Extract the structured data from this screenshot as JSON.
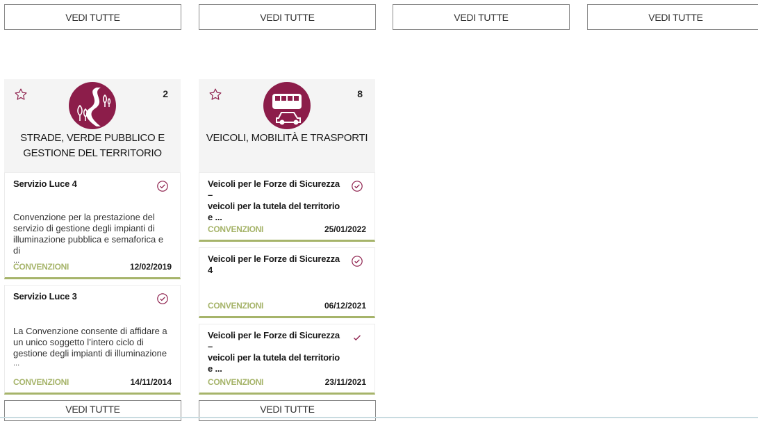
{
  "top_buttons": [
    "VEDI TUTTE",
    "VEDI TUTTE",
    "VEDI TUTTE",
    "VEDI TUTTE"
  ],
  "colors": {
    "accent": "#8c1d4a",
    "category_bar": "#a6b46a",
    "card_bg": "#f4f4f4"
  },
  "categories": [
    {
      "count": "2",
      "title_line1": "STRADE, VERDE PUBBLICO E",
      "title_line2": "GESTIONE DEL TERRITORIO",
      "icon": "road-trees-icon",
      "items": [
        {
          "title": "Servizio Luce 4",
          "desc_l1": "Convenzione per la prestazione del",
          "desc_l2": "servizio di gestione degli impianti di",
          "desc_l3": "illuminazione pubblica e semaforica e di",
          "desc_l4": "...",
          "type": "CONVENZIONI",
          "date": "12/02/2019"
        },
        {
          "title": "Servizio Luce 3",
          "desc_l1": "La Convenzione consente di affidare a",
          "desc_l2": "un unico soggetto l’intero ciclo di",
          "desc_l3": "gestione degli impianti di illuminazione",
          "desc_l4": "...",
          "type": "CONVENZIONI",
          "date": "14/11/2014"
        }
      ],
      "button": "VEDI TUTTE"
    },
    {
      "count": "8",
      "title_line1": "VEICOLI, MOBILITÀ E TRASPORTI",
      "icon": "bus-car-icon",
      "items": [
        {
          "title_l1": "Veicoli per le Forze di Sicurezza –",
          "title_l2": "veicoli per la tutela del territorio e ...",
          "type": "CONVENZIONI",
          "date": "25/01/2022"
        },
        {
          "title_l1": "Veicoli per le Forze di Sicurezza 4",
          "type": "CONVENZIONI",
          "date": "06/12/2021"
        },
        {
          "title_l1": "Veicoli per le Forze di Sicurezza –",
          "title_l2": "veicoli per la tutela del territorio e ...",
          "type": "CONVENZIONI",
          "date": "23/11/2021"
        }
      ],
      "button": "VEDI TUTTE"
    }
  ]
}
